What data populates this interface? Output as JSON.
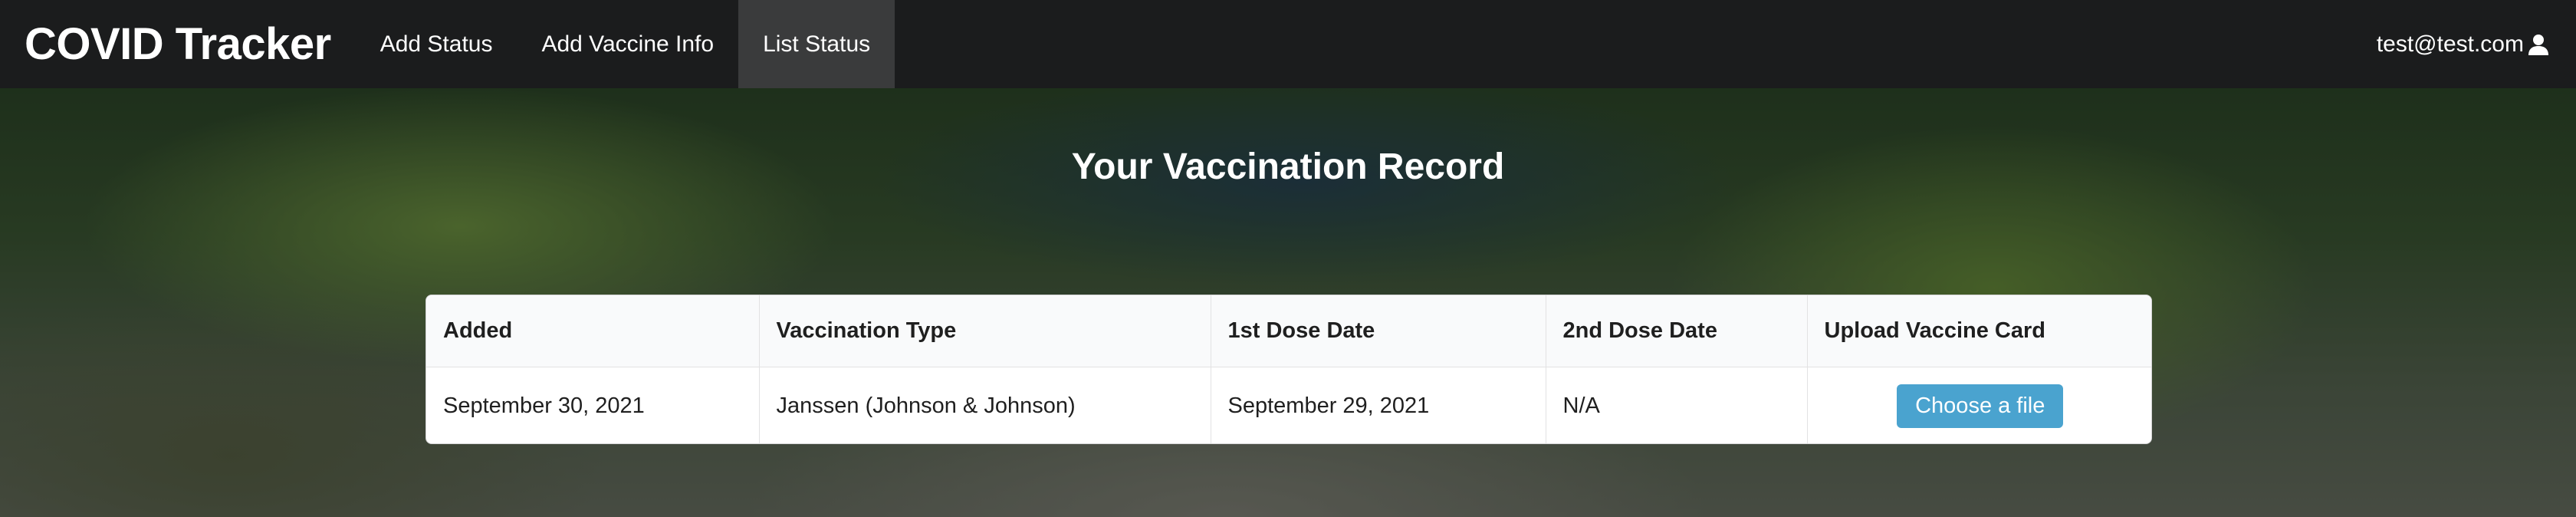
{
  "navbar": {
    "brand": "COVID Tracker",
    "items": [
      {
        "label": "Add Status"
      },
      {
        "label": "Add Vaccine Info"
      },
      {
        "label": "List Status"
      }
    ],
    "active_index": 2,
    "user_email": "test@test.com",
    "user_icon": "user-icon"
  },
  "page": {
    "title": "Your Vaccination Record"
  },
  "table": {
    "columns": [
      "Added",
      "Vaccination Type",
      "1st Dose Date",
      "2nd Dose Date",
      "Upload Vaccine Card"
    ],
    "rows": [
      {
        "added": "September 30, 2021",
        "vaccination_type": "Janssen (Johnson & Johnson)",
        "first_dose_date": "September 29, 2021",
        "second_dose_date": "N/A",
        "upload_label": "Choose a file"
      }
    ]
  },
  "colors": {
    "navbar_bg": "#1b1c1d",
    "active_nav_bg": "#3a3b3c",
    "button_accent": "#4aa3cf"
  }
}
